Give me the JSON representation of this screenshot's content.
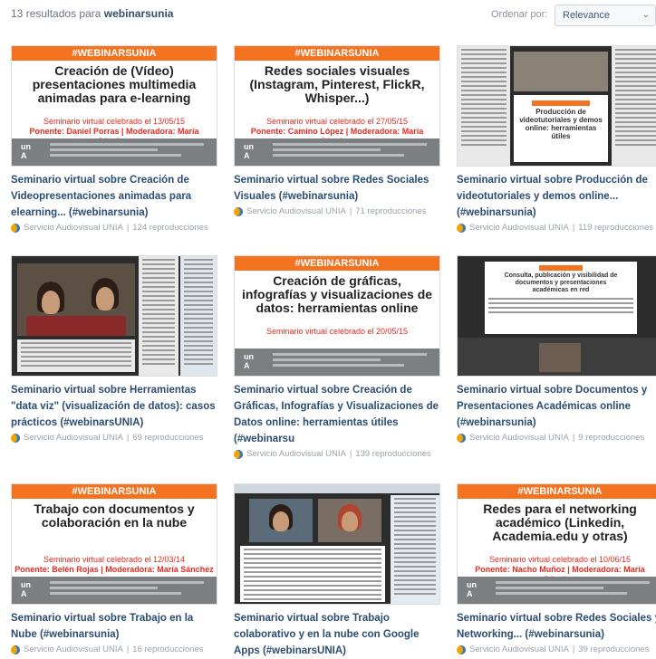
{
  "header": {
    "results_count": "13",
    "results_text": "resultados para",
    "query": "webinarsunia",
    "sort_label": "Ordenar por:",
    "sort_value": "Relevance"
  },
  "colors": {
    "accent": "#f47321",
    "title_link": "#2b4d73",
    "red": "#e52a1f"
  },
  "cards": [
    {
      "title": "Seminario virtual sobre Creación de Videopresentaciones animadas para elearning... (#webinarsunia)",
      "author": "Servicio Audiovisual UNIA",
      "plays": "124 reproducciones",
      "thumb": {
        "kind": "poster",
        "tag": "#WEBINARSUNIA",
        "title": "Creación de (Vídeo) presentaciones multimedia animadas para e-learning",
        "seminar": "Seminario virtual celebrado el 13/05/15",
        "speaker": "Ponente: Daniel Porras | Moderadora: María Sánchez"
      }
    },
    {
      "title": "Seminario virtual sobre Redes Sociales Visuales (#webinarsunia)",
      "author": "Servicio Audiovisual UNIA",
      "plays": "71 reproducciones",
      "thumb": {
        "kind": "poster",
        "tag": "#WEBINARSUNIA",
        "title": "Redes sociales visuales (Instagram, Pinterest, FlickR, Whisper...)",
        "seminar": "Seminario virtual celebrado el 27/05/15",
        "speaker": "Ponente: Camino López | Moderadora: María Sánchez"
      }
    },
    {
      "title": "Seminario virtual sobre Producción de videotutoriales y demos online... (#webinarsunia)",
      "author": "Servicio Audiovisual UNIA",
      "plays": "119 reproducciones",
      "thumb": {
        "kind": "screen",
        "caption": "Producción de videotutoriales y demos online: herramientas útiles"
      }
    },
    {
      "title": "Seminario virtual sobre Herramientas \"data viz\" (visualización de datos): casos prácticos (#webinarsUNIA)",
      "author": "Servicio Audiovisual UNIA",
      "plays": "69 reproducciones",
      "thumb": {
        "kind": "screen",
        "caption": ""
      }
    },
    {
      "title": "Seminario virtual sobre Creación de Gráficas, Infografías y Visualizaciones de Datos online: herramientas útiles (#webinarsu",
      "author": "Servicio Audiovisual UNIA",
      "plays": "139 reproducciones",
      "thumb": {
        "kind": "poster",
        "tag": "#WEBINARSUNIA",
        "title": "Creación de gráficas, infografías y visualizaciones de datos: herramientas online",
        "seminar": "Seminario virtual celebrado el 20/05/15",
        "speaker": ""
      }
    },
    {
      "title": "Seminario virtual sobre Documentos y Presentaciones Académicas online (#webinarsunia)",
      "author": "Servicio Audiovisual UNIA",
      "plays": "9 reproducciones",
      "thumb": {
        "kind": "screen",
        "caption": "Consulta, publicación y visibilidad de documentos y presentaciones académicas en red"
      }
    },
    {
      "title": "Seminario virtual sobre Trabajo en la Nube (#webinarsunia)",
      "author": "Servicio Audiovisual UNIA",
      "plays": "16 reproducciones",
      "thumb": {
        "kind": "poster",
        "tag": "#WEBINARSUNIA",
        "title": "Trabajo con documentos y colaboración en la nube",
        "seminar": "Seminario virtual celebrado el 12/03/14",
        "speaker": "Ponente: Belén Rojas | Moderadora: María Sánchez"
      }
    },
    {
      "title": "Seminario virtual sobre Trabajo colaborativo y en la nube con Google Apps (#webinarsUNIA)",
      "author": "",
      "plays": "",
      "thumb": {
        "kind": "screen",
        "caption": ""
      }
    },
    {
      "title": "Seminario virtual sobre Redes Sociales y Networking... (#webinarsunia)",
      "author": "Servicio Audiovisual UNIA",
      "plays": "39 reproducciones",
      "thumb": {
        "kind": "poster",
        "tag": "#WEBINARSUNIA",
        "title": "Redes para el networking académico (Linkedin, Academia.edu y otras)",
        "seminar": "Seminario virtual celebrado el 10/06/15",
        "speaker": "Ponente: Nacho Muñoz | Moderadora: María Sánchez"
      }
    }
  ]
}
